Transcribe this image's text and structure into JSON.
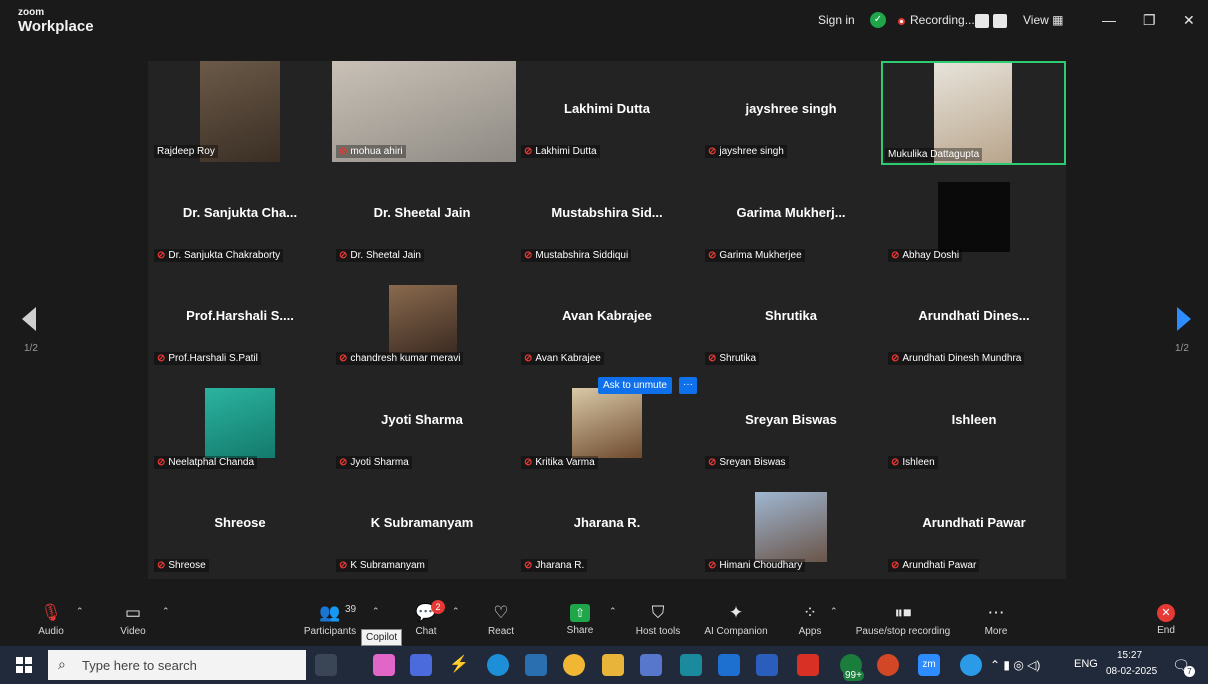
{
  "titlebar": {
    "logo_small": "zoom",
    "logo_main": "Workplace",
    "sign_in": "Sign in",
    "recording": "Recording...",
    "view": "View"
  },
  "gallery": {
    "page_label_left": "1/2",
    "page_label_right": "1/2",
    "unmute_label": "Ask to unmute",
    "unmute_more": "···",
    "tiles": [
      {
        "big": "",
        "label": "Rajdeep Roy"
      },
      {
        "big": "",
        "label": "mohua ahiri"
      },
      {
        "big": "Lakhimi Dutta",
        "label": "Lakhimi Dutta"
      },
      {
        "big": "jayshree singh",
        "label": "jayshree singh"
      },
      {
        "big": "",
        "label": "Mukulika Dattagupta"
      },
      {
        "big": "Dr. Sanjukta Cha...",
        "label": "Dr. Sanjukta Chakraborty"
      },
      {
        "big": "Dr. Sheetal Jain",
        "label": "Dr. Sheetal Jain"
      },
      {
        "big": "Mustabshira Sid...",
        "label": "Mustabshira Siddiqui"
      },
      {
        "big": "Garima Mukherj...",
        "label": "Garima Mukherjee"
      },
      {
        "big": "",
        "label": "Abhay Doshi"
      },
      {
        "big": "Prof.Harshali S....",
        "label": "Prof.Harshali S.Patil"
      },
      {
        "big": "",
        "label": "chandresh kumar meravi"
      },
      {
        "big": "Avan Kabrajee",
        "label": "Avan Kabrajee"
      },
      {
        "big": "Shrutika",
        "label": "Shrutika"
      },
      {
        "big": "Arundhati Dines...",
        "label": "Arundhati Dinesh Mundhra"
      },
      {
        "big": "",
        "label": "Neelatphal Chanda"
      },
      {
        "big": "Jyoti Sharma",
        "label": "Jyoti Sharma"
      },
      {
        "big": "",
        "label": "Kritika Varma"
      },
      {
        "big": "Sreyan Biswas",
        "label": "Sreyan Biswas"
      },
      {
        "big": "Ishleen",
        "label": "Ishleen"
      },
      {
        "big": "Shreose",
        "label": "Shreose"
      },
      {
        "big": "K Subramanyam",
        "label": "K Subramanyam"
      },
      {
        "big": "Jharana R.",
        "label": "Jharana R."
      },
      {
        "big": "",
        "label": "Himani Choudhary"
      },
      {
        "big": "Arundhati Pawar",
        "label": "Arundhati Pawar"
      }
    ]
  },
  "toolbar": {
    "audio": "Audio",
    "video": "Video",
    "participants": "Participants",
    "participants_count": "39",
    "chat": "Chat",
    "chat_badge": "2",
    "react": "React",
    "share": "Share",
    "host_tools": "Host tools",
    "ai_companion": "AI Companion",
    "apps": "Apps",
    "pause_recording": "Pause/stop recording",
    "more": "More",
    "end": "End",
    "tooltip": "Copilot"
  },
  "taskbar": {
    "search_placeholder": "Type here to search",
    "language": "ENG",
    "time": "15:27",
    "date": "08-02-2025",
    "notif_count": "99+",
    "notif_badge": "7"
  },
  "colors": {
    "accent_blue": "#0e71eb",
    "active_speaker": "#2ecc71",
    "muted_red": "#e53935"
  }
}
